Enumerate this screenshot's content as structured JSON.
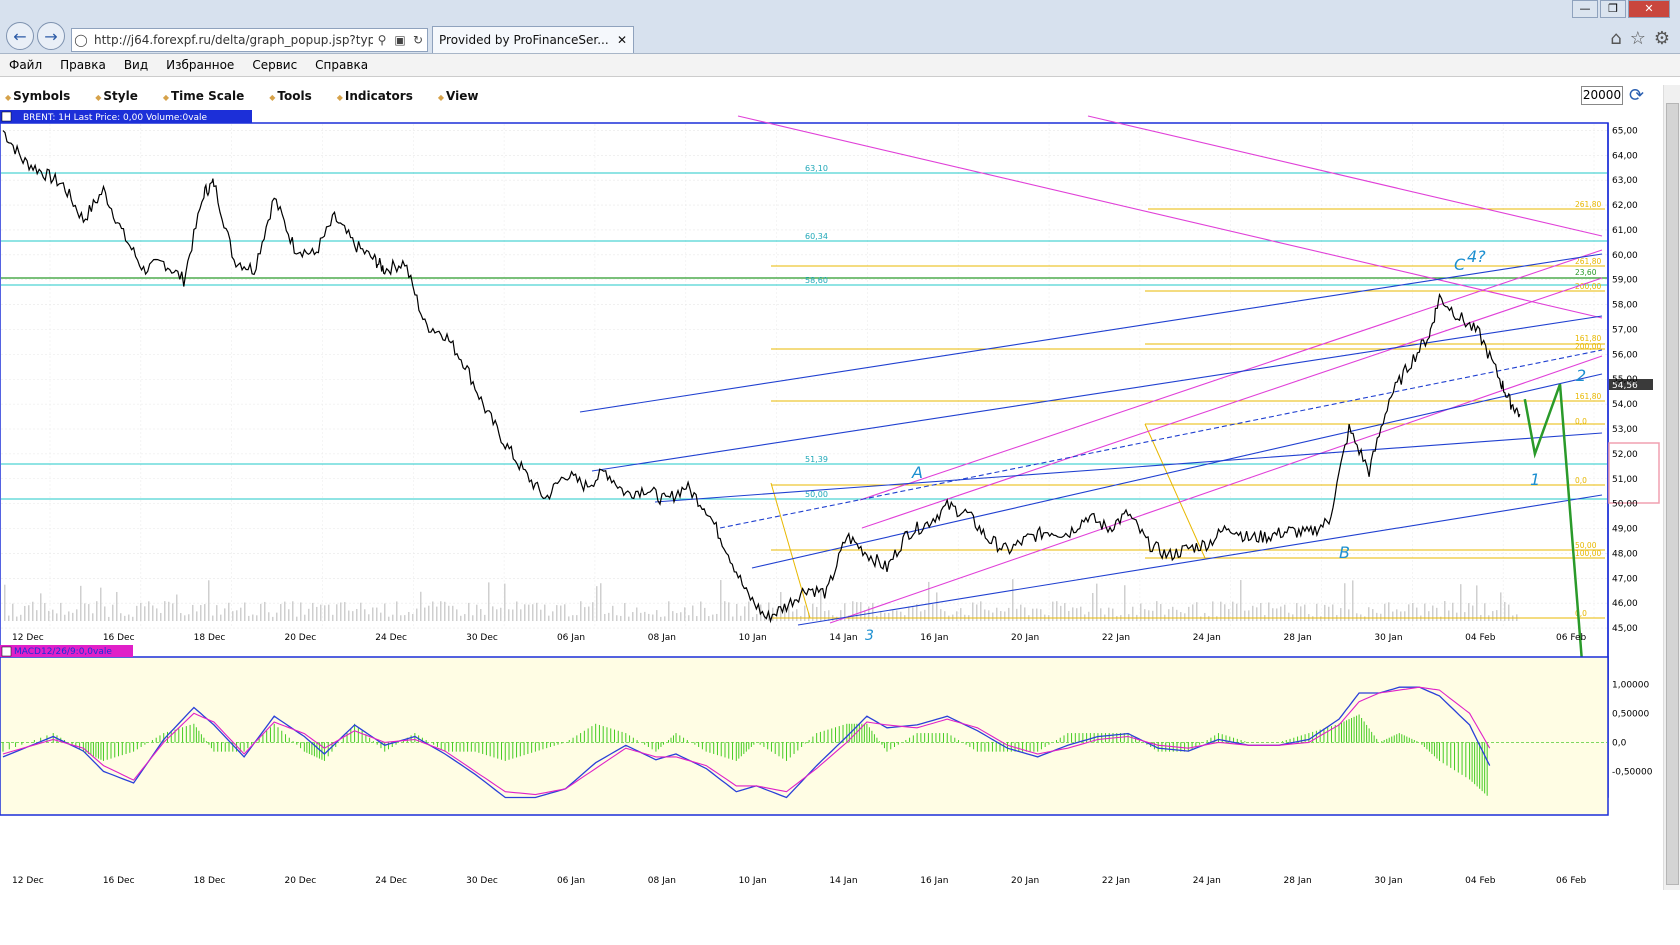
{
  "browser": {
    "address": "http://j64.forexpf.ru/delta/graph_popup.jsp?type=",
    "tab_title": "Provided by ProFinanceSer...",
    "window_controls": [
      "—",
      "❐",
      "✕"
    ]
  },
  "menu": [
    "Файл",
    "Правка",
    "Вид",
    "Избранное",
    "Сервис",
    "Справка"
  ],
  "chart_menu": [
    "Symbols",
    "Style",
    "Time Scale",
    "Tools",
    "Indicators",
    "View"
  ],
  "zoom_value": "20000",
  "price_panel": {
    "header": "BRENT: 1H Last Price: 0,00 Volume:0vale",
    "last_price_label": "54,56"
  },
  "macd_panel": {
    "header": "MACD12/26/9:0,0vale"
  },
  "annotations": {
    "A": "A",
    "B": "B",
    "C": "C",
    "w4": "4?",
    "w3_low": "3",
    "w1": "1",
    "w2": "2",
    "w3": "3"
  },
  "fib_labels": {
    "f6310": "63,10",
    "f6034": "60,34",
    "f5860": "58,60",
    "f5139": "51,39",
    "f5000": "50,00",
    "r26180a": "261,80",
    "r26180b": "261,80",
    "r2360": "23,60",
    "r20000": "200,00",
    "r16180": "161,80",
    "r20000b": "200,00",
    "r16180b": "161,80",
    "r00": "0,0",
    "r00b": "0,0",
    "r5000": "50,00",
    "r10000": "100,00",
    "r00c": "0,0"
  },
  "chart_data": {
    "type": "line",
    "title": "BRENT: 1H",
    "x_ticks": [
      "12 Dec",
      "16 Dec",
      "18 Dec",
      "20 Dec",
      "24 Dec",
      "30 Dec",
      "06 Jan",
      "08 Jan",
      "10 Jan",
      "14 Jan",
      "16 Jan",
      "20 Jan",
      "22 Jan",
      "24 Jan",
      "28 Jan",
      "30 Jan",
      "04 Feb",
      "06 Feb"
    ],
    "y_ticks": [
      "65,00",
      "64,00",
      "63,00",
      "62,00",
      "61,00",
      "60,00",
      "59,00",
      "58,00",
      "57,00",
      "56,00",
      "55,00",
      "54,00",
      "53,00",
      "52,00",
      "51,00",
      "50,00",
      "49,00",
      "48,00",
      "47,00",
      "46,00",
      "45,00"
    ],
    "ylim": [
      44.8,
      65.3
    ],
    "price_series": [
      [
        0,
        65.0
      ],
      [
        2,
        63.8
      ],
      [
        4,
        63.3
      ],
      [
        6,
        62.8
      ],
      [
        8,
        61.4
      ],
      [
        10,
        62.6
      ],
      [
        12,
        60.8
      ],
      [
        14,
        59.4
      ],
      [
        16,
        59.7
      ],
      [
        18,
        59.0
      ],
      [
        20,
        62.5
      ],
      [
        21,
        62.9
      ],
      [
        23,
        59.8
      ],
      [
        25,
        59.4
      ],
      [
        27,
        62.3
      ],
      [
        29,
        60.3
      ],
      [
        31,
        60.0
      ],
      [
        33,
        61.5
      ],
      [
        35,
        60.4
      ],
      [
        37,
        59.8
      ],
      [
        38,
        59.4
      ],
      [
        40,
        59.7
      ],
      [
        42,
        57.2
      ],
      [
        44,
        56.8
      ],
      [
        46,
        55.6
      ],
      [
        48,
        53.8
      ],
      [
        50,
        52.4
      ],
      [
        52,
        51.2
      ],
      [
        54,
        50.2
      ],
      [
        56,
        51.2
      ],
      [
        58,
        50.7
      ],
      [
        60,
        51.3
      ],
      [
        62,
        50.4
      ],
      [
        64,
        50.6
      ],
      [
        66,
        50.1
      ],
      [
        68,
        50.7
      ],
      [
        70,
        49.8
      ],
      [
        72,
        48.2
      ],
      [
        74,
        46.4
      ],
      [
        76,
        45.4
      ],
      [
        78,
        45.9
      ],
      [
        80,
        46.6
      ],
      [
        82,
        46.4
      ],
      [
        84,
        48.7
      ],
      [
        86,
        48.0
      ],
      [
        88,
        47.4
      ],
      [
        90,
        48.8
      ],
      [
        92,
        49.2
      ],
      [
        94,
        49.9
      ],
      [
        96,
        49.6
      ],
      [
        98,
        48.6
      ],
      [
        100,
        48.1
      ],
      [
        102,
        48.6
      ],
      [
        104,
        48.9
      ],
      [
        106,
        48.8
      ],
      [
        108,
        49.5
      ],
      [
        110,
        49.0
      ],
      [
        112,
        49.6
      ],
      [
        114,
        48.4
      ],
      [
        116,
        47.9
      ],
      [
        118,
        48.2
      ],
      [
        120,
        48.4
      ],
      [
        122,
        49.1
      ],
      [
        124,
        48.6
      ],
      [
        126,
        48.7
      ],
      [
        128,
        48.9
      ],
      [
        130,
        48.8
      ],
      [
        132,
        49.3
      ],
      [
        134,
        53.0
      ],
      [
        136,
        51.3
      ],
      [
        138,
        54.2
      ],
      [
        140,
        55.6
      ],
      [
        142,
        56.8
      ],
      [
        143,
        58.3
      ],
      [
        145,
        57.5
      ],
      [
        147,
        56.8
      ],
      [
        149,
        55.0
      ],
      [
        150,
        54.1
      ],
      [
        151,
        53.6
      ]
    ],
    "x_range": [
      0,
      155
    ],
    "projection": [
      [
        151.5,
        54.2
      ],
      [
        152.5,
        52.0
      ],
      [
        155,
        54.8
      ],
      [
        157,
        45.0
      ]
    ],
    "macd_ylim": [
      -1.2,
      1.35
    ],
    "macd_ticks": [
      "1,00000",
      "0,50000",
      "0,0",
      "-0,50000"
    ],
    "macd": [
      [
        0,
        -0.25
      ],
      [
        5,
        0.1
      ],
      [
        8,
        -0.15
      ],
      [
        10,
        -0.5
      ],
      [
        13,
        -0.7
      ],
      [
        16,
        0.05
      ],
      [
        19,
        0.6
      ],
      [
        21,
        0.3
      ],
      [
        24,
        -0.25
      ],
      [
        27,
        0.45
      ],
      [
        30,
        0.1
      ],
      [
        32,
        -0.2
      ],
      [
        35,
        0.3
      ],
      [
        38,
        -0.05
      ],
      [
        41,
        0.1
      ],
      [
        44,
        -0.2
      ],
      [
        47,
        -0.55
      ],
      [
        50,
        -0.95
      ],
      [
        53,
        -0.95
      ],
      [
        56,
        -0.8
      ],
      [
        59,
        -0.35
      ],
      [
        62,
        -0.05
      ],
      [
        65,
        -0.3
      ],
      [
        67,
        -0.2
      ],
      [
        70,
        -0.45
      ],
      [
        73,
        -0.85
      ],
      [
        75,
        -0.75
      ],
      [
        78,
        -0.95
      ],
      [
        81,
        -0.4
      ],
      [
        84,
        0.1
      ],
      [
        86,
        0.45
      ],
      [
        88,
        0.25
      ],
      [
        91,
        0.3
      ],
      [
        94,
        0.45
      ],
      [
        97,
        0.2
      ],
      [
        100,
        -0.1
      ],
      [
        103,
        -0.25
      ],
      [
        106,
        -0.05
      ],
      [
        109,
        0.1
      ],
      [
        112,
        0.15
      ],
      [
        115,
        -0.1
      ],
      [
        118,
        -0.15
      ],
      [
        121,
        0.05
      ],
      [
        124,
        -0.05
      ],
      [
        127,
        -0.05
      ],
      [
        130,
        0.05
      ],
      [
        133,
        0.4
      ],
      [
        135,
        0.85
      ],
      [
        137,
        0.85
      ],
      [
        139,
        0.95
      ],
      [
        141,
        0.95
      ],
      [
        143,
        0.8
      ],
      [
        146,
        0.3
      ],
      [
        148,
        -0.4
      ]
    ],
    "macd_signal": [
      [
        0,
        -0.2
      ],
      [
        5,
        0.05
      ],
      [
        8,
        -0.1
      ],
      [
        10,
        -0.4
      ],
      [
        13,
        -0.65
      ],
      [
        16,
        0.0
      ],
      [
        19,
        0.5
      ],
      [
        21,
        0.35
      ],
      [
        24,
        -0.2
      ],
      [
        27,
        0.35
      ],
      [
        30,
        0.15
      ],
      [
        32,
        -0.1
      ],
      [
        35,
        0.2
      ],
      [
        38,
        0.0
      ],
      [
        41,
        0.05
      ],
      [
        44,
        -0.15
      ],
      [
        47,
        -0.5
      ],
      [
        50,
        -0.85
      ],
      [
        53,
        -0.9
      ],
      [
        56,
        -0.8
      ],
      [
        59,
        -0.45
      ],
      [
        62,
        -0.1
      ],
      [
        65,
        -0.25
      ],
      [
        67,
        -0.25
      ],
      [
        70,
        -0.4
      ],
      [
        73,
        -0.75
      ],
      [
        75,
        -0.75
      ],
      [
        78,
        -0.85
      ],
      [
        81,
        -0.45
      ],
      [
        84,
        0.0
      ],
      [
        86,
        0.35
      ],
      [
        88,
        0.3
      ],
      [
        91,
        0.25
      ],
      [
        94,
        0.4
      ],
      [
        97,
        0.25
      ],
      [
        100,
        -0.05
      ],
      [
        103,
        -0.2
      ],
      [
        106,
        -0.1
      ],
      [
        109,
        0.05
      ],
      [
        112,
        0.1
      ],
      [
        115,
        -0.05
      ],
      [
        118,
        -0.1
      ],
      [
        121,
        0.0
      ],
      [
        124,
        -0.05
      ],
      [
        127,
        -0.05
      ],
      [
        130,
        0.0
      ],
      [
        133,
        0.3
      ],
      [
        135,
        0.7
      ],
      [
        137,
        0.85
      ],
      [
        139,
        0.9
      ],
      [
        141,
        0.95
      ],
      [
        143,
        0.9
      ],
      [
        146,
        0.5
      ],
      [
        148,
        -0.1
      ]
    ],
    "legend": "none",
    "grid": true
  },
  "colors": {
    "price": "#000000",
    "cyan": "#20c8c8",
    "yellow": "#e8b800",
    "magenta": "#e040d8",
    "blue": "#2040d0",
    "green": "#2a9a2a",
    "annot": "#1c8fd0",
    "macd_bg": "#fffde4",
    "macd_line": "#2a40d8",
    "signal_line": "#e020c8",
    "hist": "#44cc22"
  }
}
